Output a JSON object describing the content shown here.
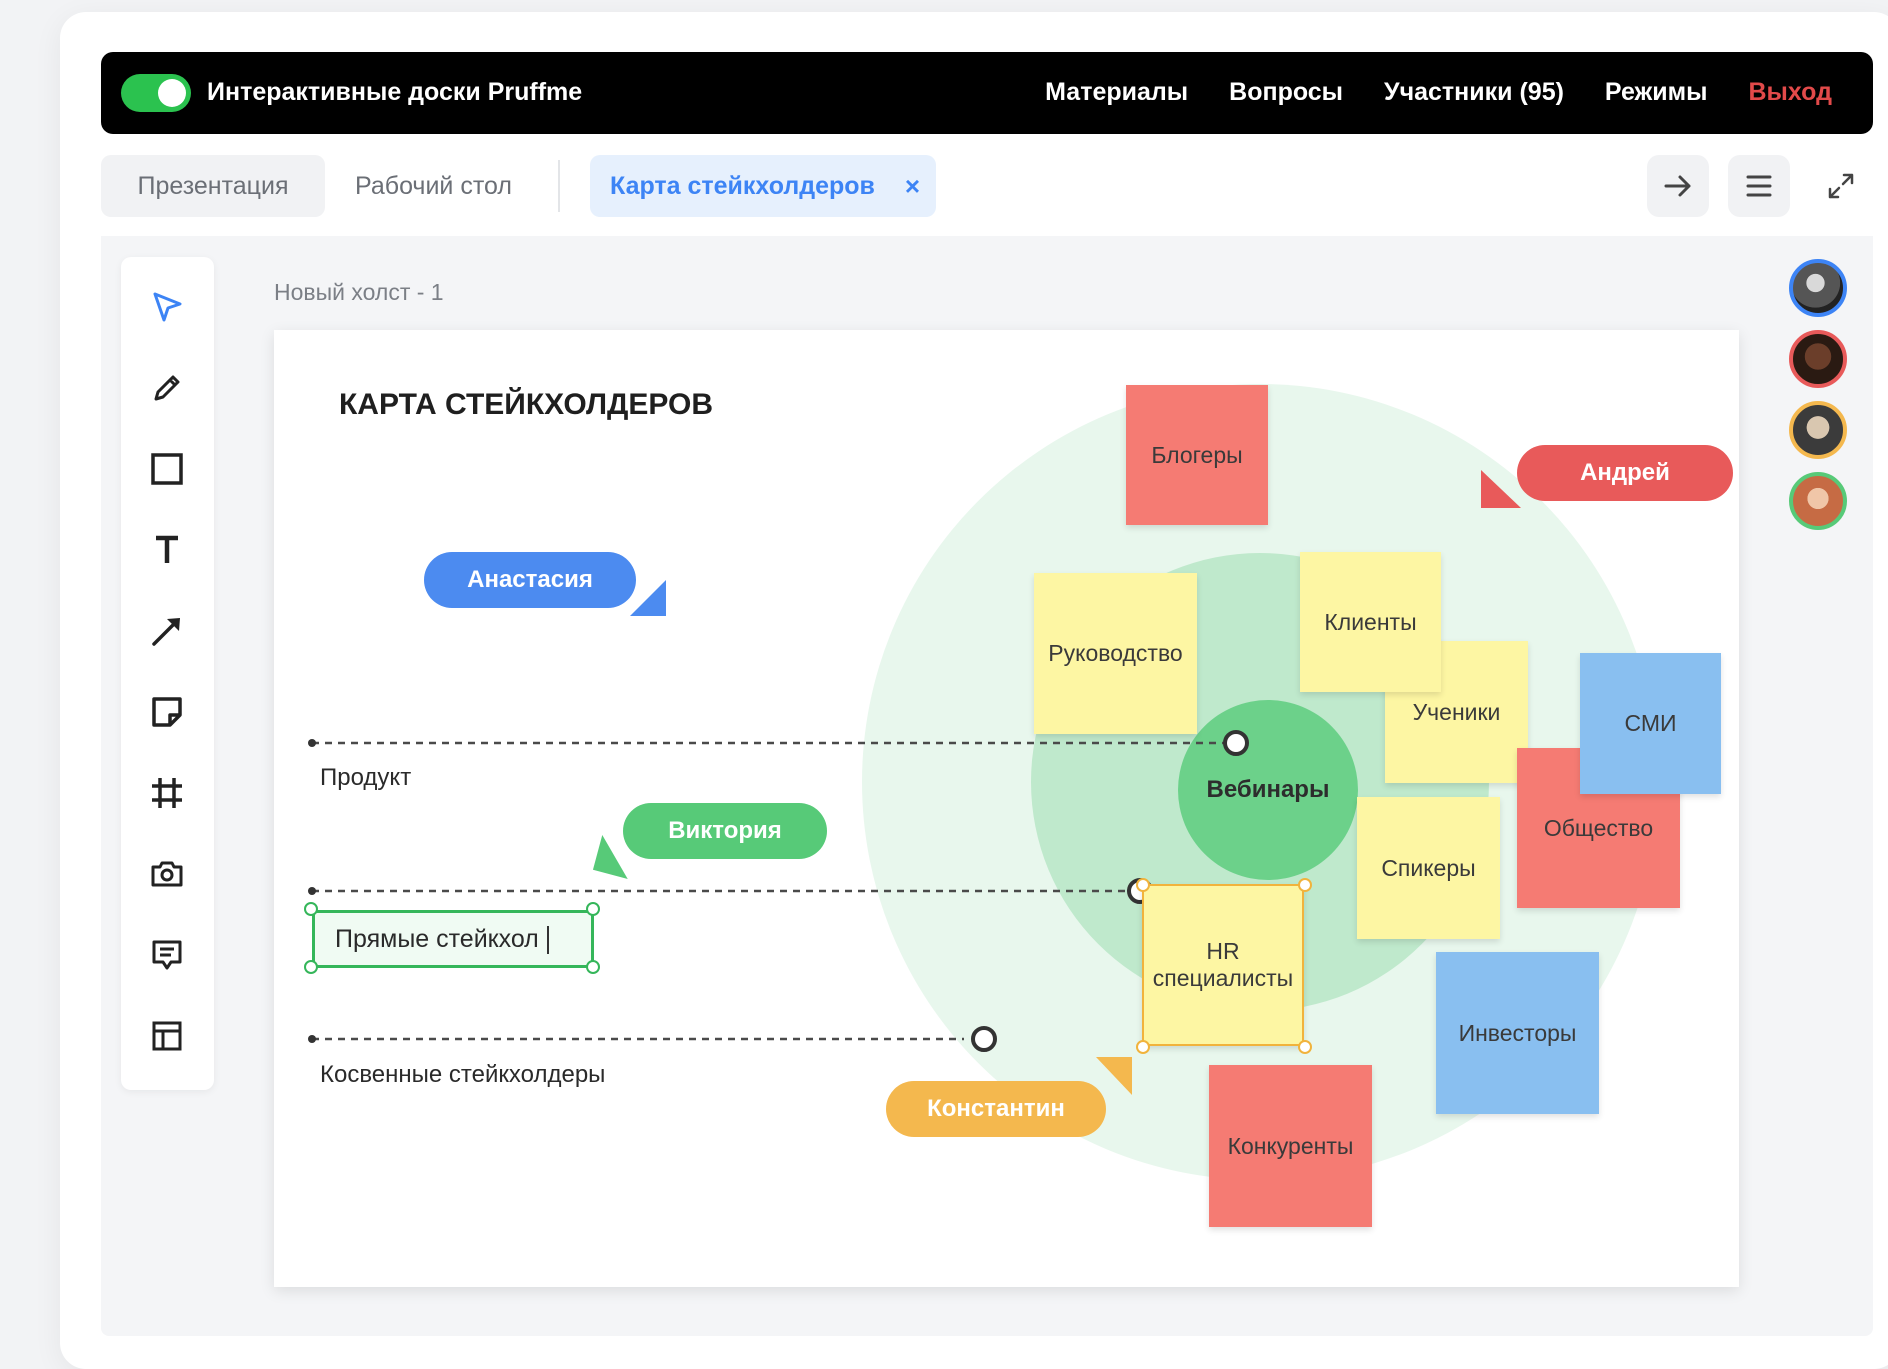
{
  "app_title": "Интерактивные доски Pruffme",
  "nav": {
    "materials": "Материалы",
    "questions": "Вопросы",
    "participants": "Участники (95)",
    "modes": "Режимы",
    "exit": "Выход"
  },
  "tabs": {
    "presentation": "Презентация",
    "desktop": "Рабочий стол",
    "active": "Карта стейкхолдеров",
    "close": "×"
  },
  "canvas": {
    "name": "Новый холст - 1",
    "board_title": "КАРТА СТЕЙКХОЛДЕРОВ"
  },
  "rows": {
    "product": "Продукт",
    "direct_text": "Прямые стейкхол",
    "indirect": "Косвенные стейкхолдеры"
  },
  "hub": "Вебинары",
  "stickies": {
    "bloggers": "Блогеры",
    "management": "Руководство",
    "clients": "Клиенты",
    "students": "Ученики",
    "media": "СМИ",
    "society": "Общество",
    "speakers": "Спикеры",
    "hr_line1": "HR",
    "hr_line2": "специалисты",
    "investors": "Инвесторы",
    "competitors": "Конкуренты"
  },
  "cursors": {
    "anastasia": "Анастасия",
    "andrey": "Андрей",
    "victoria": "Виктория",
    "konstantin": "Константин"
  },
  "colors": {
    "toggle_green": "#2bc24f",
    "exit_red": "#e24a4a",
    "active_tab_blue": "#3d84f5",
    "sticky_yellow": "#fdf6a3",
    "sticky_red": "#f57b73",
    "sticky_blue": "#89bff0",
    "cursor_blue": "#4c8bf0",
    "cursor_red": "#e85a5a",
    "cursor_green": "#57ca78",
    "cursor_orange": "#f4b84e"
  },
  "icons": {
    "tools": [
      "select-icon",
      "pencil-icon",
      "rectangle-icon",
      "text-icon",
      "arrow-icon",
      "sticky-note-icon",
      "frame-icon",
      "camera-icon",
      "comment-icon",
      "template-icon"
    ],
    "top_right": [
      "arrow-right-icon",
      "menu-icon",
      "expand-icon"
    ]
  }
}
